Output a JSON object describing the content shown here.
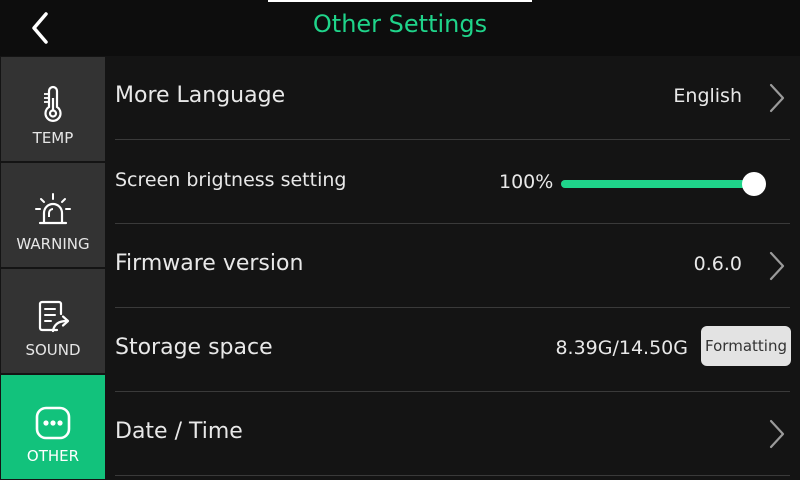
{
  "header": {
    "title": "Other Settings",
    "back_icon": "chevron-left-icon",
    "title_color": "#1fd48a"
  },
  "sidebar": {
    "items": [
      {
        "label": "TEMP",
        "icon": "thermometer-icon"
      },
      {
        "label": "WARNING",
        "icon": "siren-icon"
      },
      {
        "label": "SOUND",
        "icon": "document-share-icon"
      },
      {
        "label": "OTHER",
        "icon": "more-dots-icon",
        "active": true
      }
    ],
    "active_color": "#12c27c"
  },
  "rows": {
    "language": {
      "label": "More Language",
      "value": "English"
    },
    "brightness": {
      "label": "Screen brigtness setting",
      "value": "100%",
      "level": 1.0
    },
    "firmware": {
      "label": "Firmware version",
      "value": "0.6.0"
    },
    "storage": {
      "label": "Storage space",
      "value": "8.39G/14.50G",
      "button": "Formatting"
    },
    "datetime": {
      "label": "Date / Time"
    }
  }
}
